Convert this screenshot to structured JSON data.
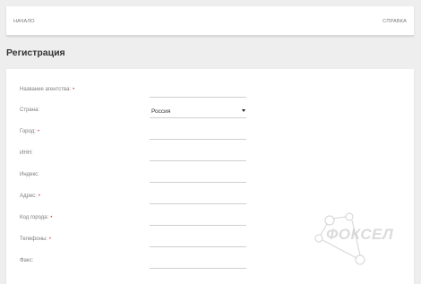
{
  "nav": {
    "home_label": "НАЧАЛО",
    "help_label": "СПРАВКА"
  },
  "page": {
    "title": "Регистрация"
  },
  "form": {
    "required_marker": "•",
    "agency_name": {
      "label": "Название агентства:",
      "required": true,
      "value": ""
    },
    "country": {
      "label": "Страна:",
      "required": false,
      "value": "Россия"
    },
    "city": {
      "label": "Город:",
      "required": true,
      "value": ""
    },
    "inn": {
      "label": "ИНН:",
      "required": false,
      "value": ""
    },
    "postal_code": {
      "label": "Индекс:",
      "required": false,
      "value": ""
    },
    "address": {
      "label": "Адрес:",
      "required": true,
      "value": ""
    },
    "city_code": {
      "label": "Код города:",
      "required": true,
      "value": ""
    },
    "phones": {
      "label": "Телефоны:",
      "required": true,
      "value": ""
    },
    "fax": {
      "label": "Факс:",
      "required": false,
      "value": ""
    }
  },
  "watermark": {
    "text": "ФОКСЕЛ"
  },
  "colors": {
    "background": "#eeeeee",
    "card": "#ffffff",
    "required": "#d9534f",
    "label": "#7d7d7d"
  }
}
